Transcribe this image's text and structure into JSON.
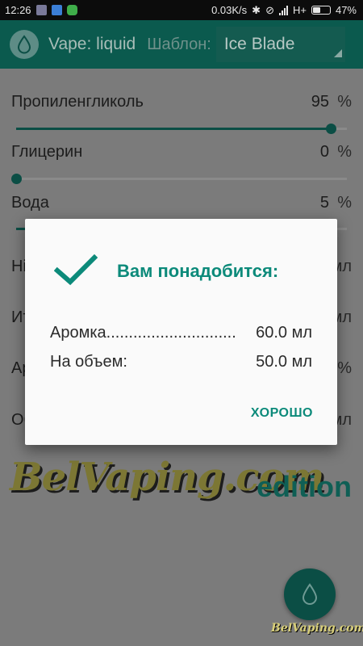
{
  "status_bar": {
    "time": "12:26",
    "speed": "0.03K/s",
    "network": "H+",
    "battery": "47%",
    "battery_level": 0.47
  },
  "appbar": {
    "title": "Vape: liquid",
    "template_label": "Шаблон:",
    "template_value": "Ice Blade"
  },
  "components": [
    {
      "name": "Пропиленгликоль",
      "value": "95",
      "unit": "%",
      "level": 0.95
    },
    {
      "name": "Глицерин",
      "value": "0",
      "unit": "%",
      "level": 0.0
    },
    {
      "name": "Вода",
      "value": "5",
      "unit": "%",
      "level": 0.05
    }
  ],
  "hidden_rows": [
    {
      "label": "Ні",
      "unit": "мл"
    },
    {
      "label": "Ит",
      "unit": "мл"
    },
    {
      "label": "Ар",
      "unit": "%"
    },
    {
      "label": "Об",
      "unit": "мл"
    }
  ],
  "branding": {
    "logo": "BelVaping.com",
    "edition": "edition",
    "watermark": "BelVaping.com"
  },
  "dialog": {
    "title": "Вам понадобится:",
    "rows": [
      {
        "label": "Аромка.............................",
        "value": "60.0 мл"
      },
      {
        "label": "На объем:",
        "value": "50.0 мл"
      }
    ],
    "ok_label": "ХОРОШО"
  },
  "colors": {
    "primary": "#0b5a4e",
    "accent": "#0c8a7a"
  }
}
